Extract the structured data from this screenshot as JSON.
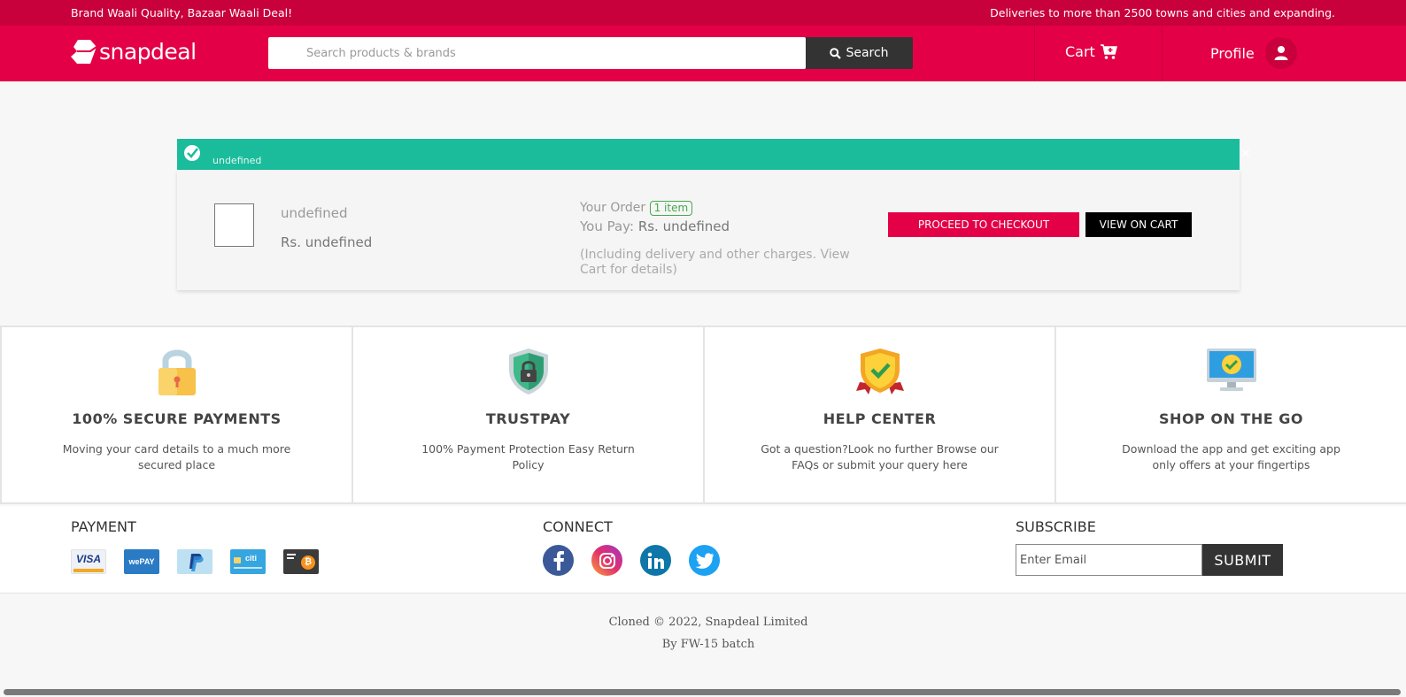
{
  "topstrip": {
    "left": "Brand Waali Quality, Bazaar Waali Deal!",
    "right": "Deliveries to more than 2500 towns and cities and expanding."
  },
  "header": {
    "logo_text": "snapdeal",
    "search_placeholder": "Search products & brands",
    "search_button": "Search",
    "cart_label": "Cart",
    "profile_label": "Profile"
  },
  "notice": {
    "message": "undefined"
  },
  "cart_card": {
    "product_name": "undefined",
    "product_price": "Rs. undefined",
    "order_label": "Your Order",
    "item_count": "1 item",
    "you_pay_label": "You Pay:",
    "you_pay_value": "Rs. undefined",
    "note": "(Including delivery and other charges. View Cart for details)",
    "checkout_button": "PROCEED TO CHECKOUT",
    "view_cart_button": "VIEW ON CART"
  },
  "features": [
    {
      "title": "100% SECURE PAYMENTS",
      "desc": "Moving your card details to a much more secured place",
      "icon": "padlock-icon"
    },
    {
      "title": "TRUSTPAY",
      "desc": "100% Payment Protection Easy Return Policy",
      "icon": "shield-lock-icon"
    },
    {
      "title": "HELP CENTER",
      "desc": "Got a question?Look no further Browse our FAQs or submit your query here",
      "icon": "badge-check-icon"
    },
    {
      "title": "SHOP ON THE GO",
      "desc": "Download the app and get exciting app only offers at your fingertips",
      "icon": "monitor-check-icon"
    }
  ],
  "footer": {
    "payment_title": "PAYMENT",
    "payment_icons": [
      "VISA",
      "wePAY",
      "paypal-icon",
      "citi",
      "bitcoin-icon"
    ],
    "connect_title": "CONNECT",
    "social": [
      "facebook-icon",
      "instagram-icon",
      "linkedin-icon",
      "twitter-icon"
    ],
    "subscribe_title": "SUBSCRIBE",
    "email_placeholder": "Enter Email",
    "submit_label": "SUBMIT"
  },
  "copyright": {
    "line1": "Cloned © 2022, Snapdeal Limited",
    "line2": "By FW-15 batch"
  },
  "colors": {
    "brand": "#e40046",
    "brand_dark": "#c8003c",
    "success": "#1abc9c"
  }
}
